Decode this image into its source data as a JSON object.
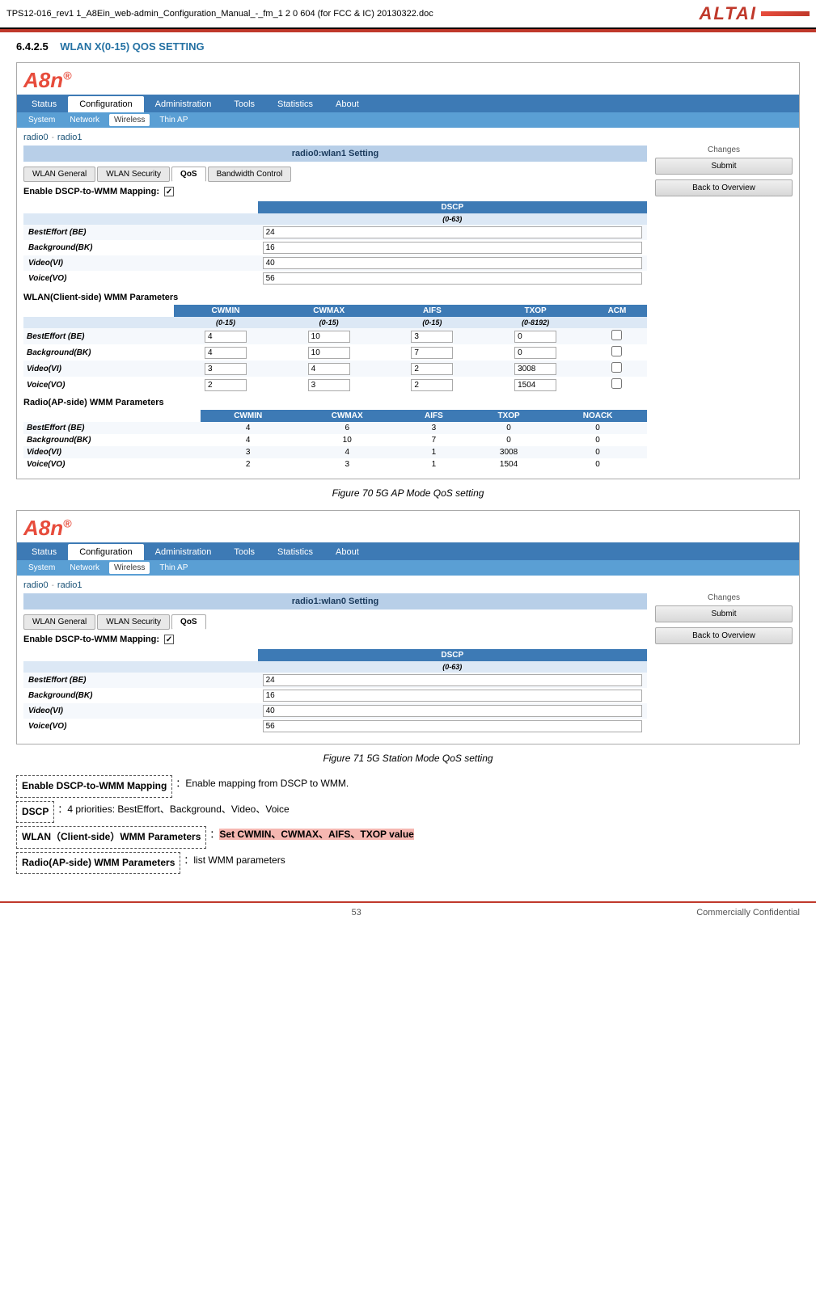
{
  "doc": {
    "header_title": "TPS12-016_rev1 1_A8Ein_web-admin_Configuration_Manual_-_fm_1 2 0 604 (for FCC & IC) 20130322.doc",
    "page_number": "53",
    "footer_right": "Commercially Confidential"
  },
  "section": {
    "number": "6.4.2.5",
    "title": "WLAN X(0-15) QOS SETTING"
  },
  "figure1": {
    "caption": "Figure 70 5G AP Mode QoS setting",
    "a8n_logo": "A8n",
    "setting_title": "radio0:wlan1 Setting",
    "nav": {
      "items": [
        "Status",
        "Configuration",
        "Administration",
        "Tools",
        "Statistics",
        "About"
      ],
      "active": "Configuration"
    },
    "subnav": {
      "items": [
        "System",
        "Network",
        "Wireless",
        "Thin AP"
      ],
      "active": "Wireless"
    },
    "radio_tabs": [
      "radio0",
      "-",
      "radio1"
    ],
    "settings_tabs": [
      "WLAN General",
      "WLAN Security",
      "QoS",
      "Bandwidth Control"
    ],
    "active_tab": "QoS",
    "enable_dscp_label": "Enable DSCP-to-WMM Mapping:",
    "enable_dscp_checked": true,
    "dscp_header": "DSCP",
    "dscp_subheader": "(0-63)",
    "dscp_rows": [
      {
        "label": "BestEffort (BE)",
        "value": "24"
      },
      {
        "label": "Background(BK)",
        "value": "16"
      },
      {
        "label": "Video(VI)",
        "value": "40"
      },
      {
        "label": "Voice(VO)",
        "value": "56"
      }
    ],
    "wlan_wmm_title": "WLAN(Client-side) WMM Parameters",
    "wlan_wmm_headers": [
      "CWMIN",
      "CWMAX",
      "AIFS",
      "TXOP",
      "ACM"
    ],
    "wlan_wmm_subheaders": [
      "(0-15)",
      "(0-15)",
      "(0-15)",
      "(0-8192)",
      ""
    ],
    "wlan_wmm_rows": [
      {
        "label": "BestEffort (BE)",
        "cwmin": "4",
        "cwmax": "10",
        "aifs": "3",
        "txop": "0",
        "acm": ""
      },
      {
        "label": "Background(BK)",
        "cwmin": "4",
        "cwmax": "10",
        "aifs": "7",
        "txop": "0",
        "acm": ""
      },
      {
        "label": "Video(VI)",
        "cwmin": "3",
        "cwmax": "4",
        "aifs": "2",
        "txop": "3008",
        "acm": ""
      },
      {
        "label": "Voice(VO)",
        "cwmin": "2",
        "cwmax": "3",
        "aifs": "2",
        "txop": "1504",
        "acm": ""
      }
    ],
    "radio_wmm_title": "Radio(AP-side) WMM Parameters",
    "radio_wmm_headers": [
      "CWMIN",
      "CWMAX",
      "AIFS",
      "TXOP",
      "NOACK"
    ],
    "radio_wmm_rows": [
      {
        "label": "BestEffort (BE)",
        "cwmin": "4",
        "cwmax": "6",
        "aifs": "3",
        "txop": "0",
        "noack": "0"
      },
      {
        "label": "Background(BK)",
        "cwmin": "4",
        "cwmax": "10",
        "aifs": "7",
        "txop": "0",
        "noack": "0"
      },
      {
        "label": "Video(VI)",
        "cwmin": "3",
        "cwmax": "4",
        "aifs": "1",
        "txop": "3008",
        "noack": "0"
      },
      {
        "label": "Voice(VO)",
        "cwmin": "2",
        "cwmax": "3",
        "aifs": "1",
        "txop": "1504",
        "noack": "0"
      }
    ],
    "sidebar": {
      "changes_label": "Changes",
      "submit_btn": "Submit",
      "back_btn": "Back to Overview"
    }
  },
  "figure2": {
    "caption": "Figure 71 5G Station Mode QoS setting",
    "a8n_logo": "A8n",
    "setting_title": "radio1:wlan0 Setting",
    "nav": {
      "items": [
        "Status",
        "Configuration",
        "Administration",
        "Tools",
        "Statistics",
        "About"
      ],
      "active": "Configuration"
    },
    "subnav": {
      "items": [
        "System",
        "Network",
        "Wireless",
        "Thin AP"
      ],
      "active": "Wireless"
    },
    "radio_tabs": [
      "radio0",
      "-",
      "radio1"
    ],
    "settings_tabs": [
      "WLAN General",
      "WLAN Security",
      "QoS"
    ],
    "active_tab": "QoS",
    "enable_dscp_label": "Enable DSCP-to-WMM Mapping:",
    "enable_dscp_checked": true,
    "dscp_header": "DSCP",
    "dscp_subheader": "(0-63)",
    "dscp_rows": [
      {
        "label": "BestEffort (BE)",
        "value": "24"
      },
      {
        "label": "Background(BK)",
        "value": "16"
      },
      {
        "label": "Video(VI)",
        "value": "40"
      },
      {
        "label": "Voice(VO)",
        "value": "56"
      }
    ],
    "sidebar": {
      "changes_label": "Changes",
      "submit_btn": "Submit",
      "back_btn": "Back to Overview"
    }
  },
  "bottom_items": [
    {
      "label": "Enable DSCP-to-WMM Mapping",
      "separator": "：",
      "text": "Enable mapping from DSCP to WMM."
    },
    {
      "label": "DSCP",
      "separator": "：",
      "text": "4 priorities: BestEffort、Background、Video、Voice"
    },
    {
      "label": "WLAN（Client-side）WMM Parameters",
      "separator": "：",
      "highlight": "Set CWMIN、CWMAX、AIFS、TXOP value"
    },
    {
      "label": "Radio(AP-side) WMM Parameters",
      "separator": "：",
      "text": "list WMM parameters"
    }
  ]
}
